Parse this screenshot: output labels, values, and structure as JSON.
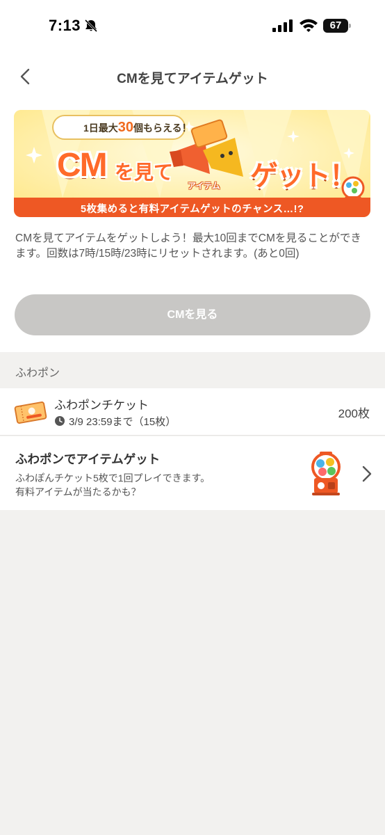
{
  "status_bar": {
    "time": "7:13",
    "battery": "67",
    "icons": [
      "bell-slash-icon",
      "signal-icon",
      "wifi-icon",
      "battery-icon"
    ]
  },
  "header": {
    "title": "CMを見てアイテムゲット",
    "back_icon": "chevron-left-icon"
  },
  "banner": {
    "limit_prefix": "1日最大",
    "limit_number": "30",
    "limit_suffix": "個もらえる！",
    "main_cm": "CM",
    "main_miru": "を見て",
    "main_item": "アイテム",
    "main_get": "ゲット！",
    "ticket_label": "ふわポン",
    "strip_text": "5枚集めると有料アイテムゲットのチャンス…!?"
  },
  "description": "CMを見てアイテムをゲットしよう！最大10回までCMを見ることができます。回数は7時/15時/23時にリセットされます。(あと0回)",
  "watch_button": {
    "label": "CMを見る"
  },
  "section": {
    "title": "ふわポン"
  },
  "ticket": {
    "name": "ふわポンチケット",
    "expiry": "3/9 23:59まで（15枚）",
    "count": "200枚",
    "icon_label": "ふわポン"
  },
  "gacha": {
    "title": "ふわポンでアイテムゲット",
    "desc_line1": "ふわぽんチケット5枚で1回プレイできます。",
    "desc_line2": "有料アイテムが当たるかも？"
  },
  "colors": {
    "accent_orange": "#ee5824",
    "banner_yellow": "#fff1b0",
    "button_disabled": "#c8c7c5",
    "background": "#f2f1ef"
  }
}
